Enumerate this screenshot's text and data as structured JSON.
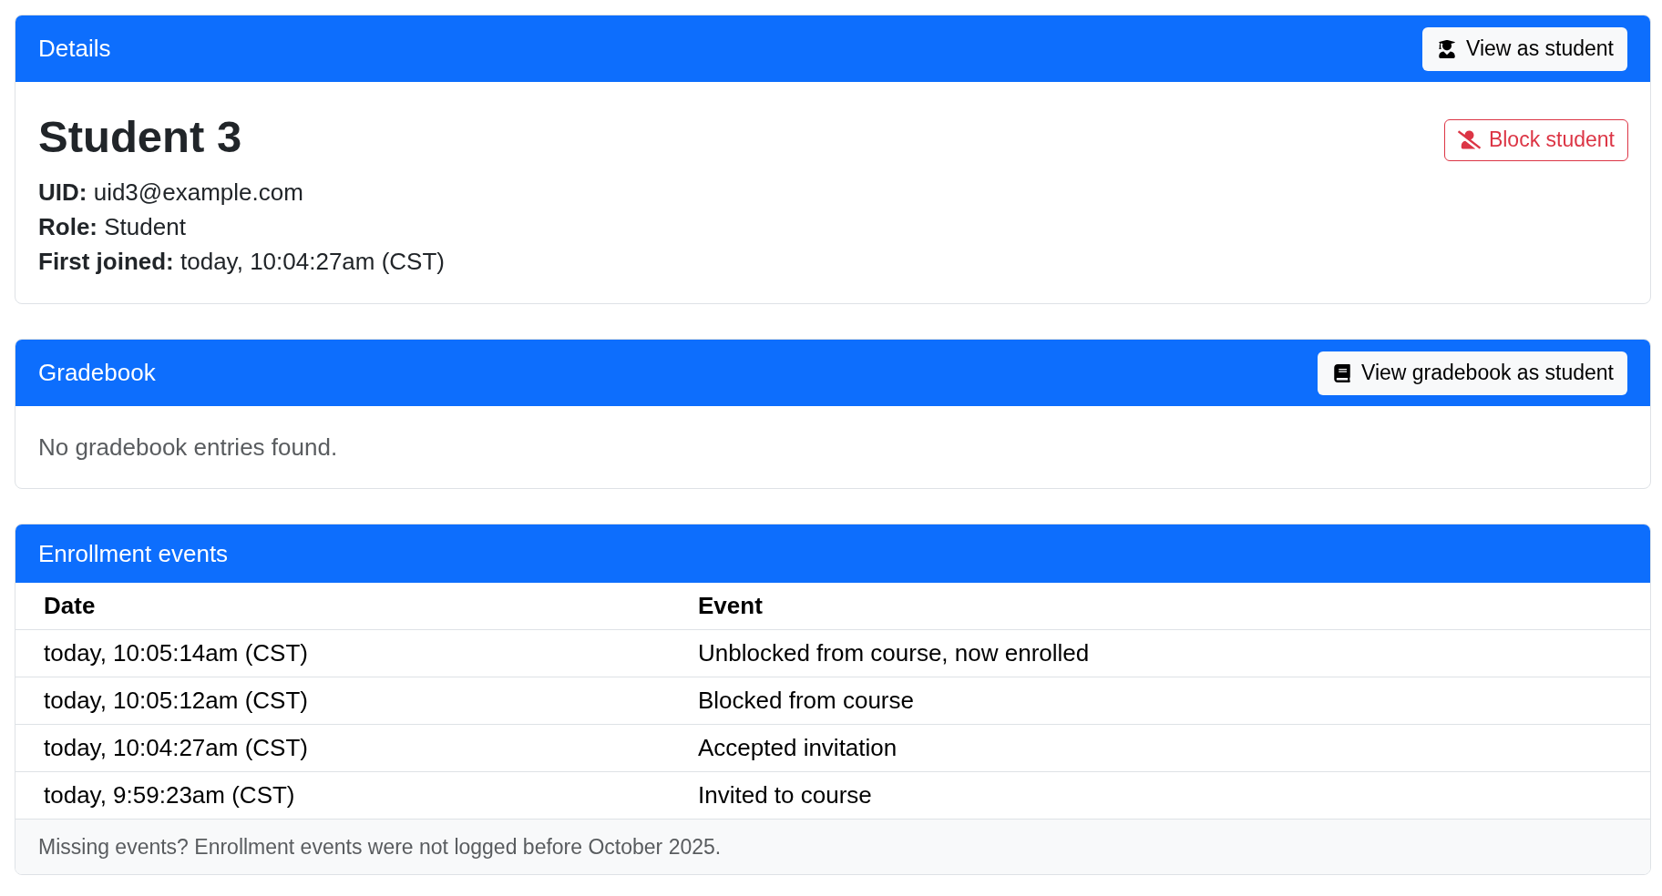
{
  "details": {
    "header": "Details",
    "header_button": "View as student",
    "name": "Student 3",
    "block_button": "Block student",
    "fields": [
      {
        "label": "UID:",
        "value": "uid3@example.com"
      },
      {
        "label": "Role:",
        "value": "Student"
      },
      {
        "label": "First joined:",
        "value": "today, 10:04:27am (CST)"
      }
    ]
  },
  "gradebook": {
    "header": "Gradebook",
    "header_button": "View gradebook as student",
    "message": "No gradebook entries found."
  },
  "enrollment_events": {
    "header": "Enrollment events",
    "table": {
      "columns": [
        "Date",
        "Event"
      ],
      "rows": [
        [
          "today, 10:05:14am (CST)",
          "Unblocked from course, now enrolled"
        ],
        [
          "today, 10:05:12am (CST)",
          "Blocked from course"
        ],
        [
          "today, 10:04:27am (CST)",
          "Accepted invitation"
        ],
        [
          "today, 9:59:23am (CST)",
          "Invited to course"
        ]
      ]
    },
    "footer": "Missing events? Enrollment events were not logged before October 2025."
  }
}
